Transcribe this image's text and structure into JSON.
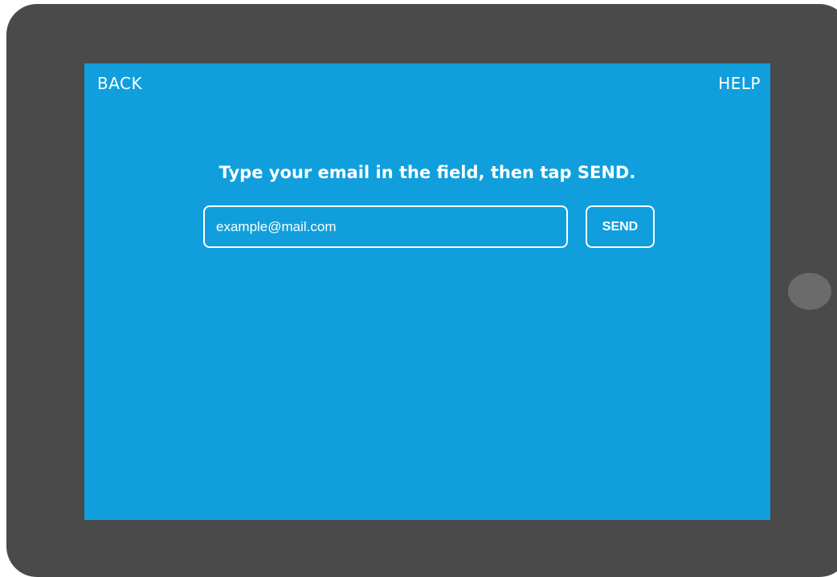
{
  "colors": {
    "device_frame": "#4a4a4a",
    "screen_background": "#109fdc",
    "home_button": "#6b6b6b",
    "text": "#ffffff"
  },
  "nav": {
    "back_label": "BACK",
    "help_label": "HELP"
  },
  "main": {
    "instruction": "Type your email in the field, then tap SEND.",
    "email": {
      "value": "",
      "placeholder": "example@mail.com"
    },
    "send_label": "SEND"
  }
}
